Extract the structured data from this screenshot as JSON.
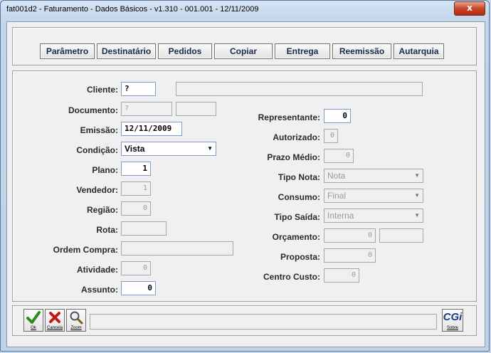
{
  "window": {
    "title": "fat001d2 - Faturamento - Dados Básicos -  v1.310 - 001.001 - 12/11/2009",
    "close_glyph": "x"
  },
  "toolbar": [
    "Parâmetro",
    "Destinatário",
    "Pedidos",
    "Copiar",
    "Entrega",
    "Reemissão",
    "Autarquia"
  ],
  "left": {
    "cliente": {
      "label": "Cliente:",
      "value": "?"
    },
    "documento": {
      "label": "Documento:",
      "value": "?"
    },
    "emissao": {
      "label": "Emissão:",
      "value": "12/11/2009"
    },
    "condicao": {
      "label": "Condição:",
      "value": "Vista"
    },
    "plano": {
      "label": "Plano:",
      "value": "1"
    },
    "vendedor": {
      "label": "Vendedor:",
      "value": "1"
    },
    "regiao": {
      "label": "Região:",
      "value": "0"
    },
    "rota": {
      "label": "Rota:",
      "value": ""
    },
    "ordem_compra": {
      "label": "Ordem Compra:",
      "value": ""
    },
    "atividade": {
      "label": "Atividade:",
      "value": "0"
    },
    "assunto": {
      "label": "Assunto:",
      "value": "0"
    }
  },
  "right": {
    "representante": {
      "label": "Representante:",
      "value": "0"
    },
    "autorizado": {
      "label": "Autorizado:",
      "value": "0"
    },
    "prazo_medio": {
      "label": "Prazo Médio:",
      "value": "0"
    },
    "tipo_nota": {
      "label": "Tipo Nota:",
      "value": "Nota"
    },
    "consumo": {
      "label": "Consumo:",
      "value": "Final"
    },
    "tipo_saida": {
      "label": "Tipo Saída:",
      "value": "Interna"
    },
    "orcamento": {
      "label": "Orçamento:",
      "value": "0"
    },
    "proposta": {
      "label": "Proposta:",
      "value": "0"
    },
    "centro_custo": {
      "label": "Centro Custo:",
      "value": "0"
    }
  },
  "footer": {
    "ok": "Ok",
    "cancela": "Cancela",
    "zoom": "Zoom",
    "sobre": "Sobre",
    "logo_text": "CGi",
    "status": ""
  },
  "icons": {
    "ok": "checkmark-icon",
    "cancela": "red-x-icon",
    "zoom": "magnifier-icon",
    "sobre": "cgi-logo-icon",
    "dropdown": "chevron-down-icon"
  },
  "colors": {
    "titlebar": "#c2d5ec",
    "close": "#c9452a",
    "label": "#2a2a2a",
    "field_border": "#7a9cc6",
    "logo": "#1b3c8c"
  }
}
